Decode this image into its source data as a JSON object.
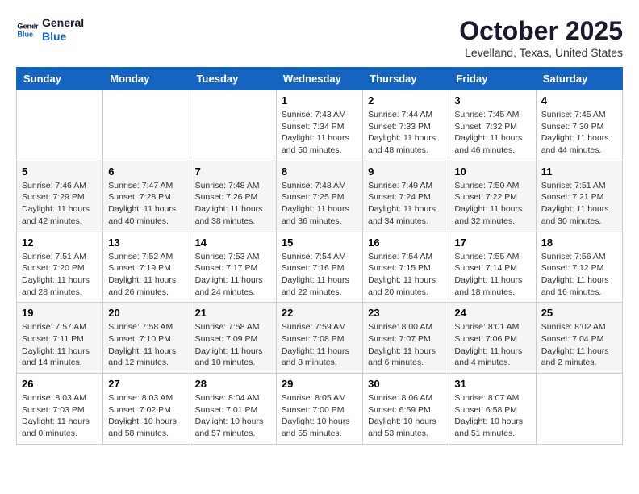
{
  "header": {
    "logo_line1": "General",
    "logo_line2": "Blue",
    "month": "October 2025",
    "location": "Levelland, Texas, United States"
  },
  "weekdays": [
    "Sunday",
    "Monday",
    "Tuesday",
    "Wednesday",
    "Thursday",
    "Friday",
    "Saturday"
  ],
  "weeks": [
    [
      {
        "day": "",
        "content": ""
      },
      {
        "day": "",
        "content": ""
      },
      {
        "day": "",
        "content": ""
      },
      {
        "day": "1",
        "content": "Sunrise: 7:43 AM\nSunset: 7:34 PM\nDaylight: 11 hours\nand 50 minutes."
      },
      {
        "day": "2",
        "content": "Sunrise: 7:44 AM\nSunset: 7:33 PM\nDaylight: 11 hours\nand 48 minutes."
      },
      {
        "day": "3",
        "content": "Sunrise: 7:45 AM\nSunset: 7:32 PM\nDaylight: 11 hours\nand 46 minutes."
      },
      {
        "day": "4",
        "content": "Sunrise: 7:45 AM\nSunset: 7:30 PM\nDaylight: 11 hours\nand 44 minutes."
      }
    ],
    [
      {
        "day": "5",
        "content": "Sunrise: 7:46 AM\nSunset: 7:29 PM\nDaylight: 11 hours\nand 42 minutes."
      },
      {
        "day": "6",
        "content": "Sunrise: 7:47 AM\nSunset: 7:28 PM\nDaylight: 11 hours\nand 40 minutes."
      },
      {
        "day": "7",
        "content": "Sunrise: 7:48 AM\nSunset: 7:26 PM\nDaylight: 11 hours\nand 38 minutes."
      },
      {
        "day": "8",
        "content": "Sunrise: 7:48 AM\nSunset: 7:25 PM\nDaylight: 11 hours\nand 36 minutes."
      },
      {
        "day": "9",
        "content": "Sunrise: 7:49 AM\nSunset: 7:24 PM\nDaylight: 11 hours\nand 34 minutes."
      },
      {
        "day": "10",
        "content": "Sunrise: 7:50 AM\nSunset: 7:22 PM\nDaylight: 11 hours\nand 32 minutes."
      },
      {
        "day": "11",
        "content": "Sunrise: 7:51 AM\nSunset: 7:21 PM\nDaylight: 11 hours\nand 30 minutes."
      }
    ],
    [
      {
        "day": "12",
        "content": "Sunrise: 7:51 AM\nSunset: 7:20 PM\nDaylight: 11 hours\nand 28 minutes."
      },
      {
        "day": "13",
        "content": "Sunrise: 7:52 AM\nSunset: 7:19 PM\nDaylight: 11 hours\nand 26 minutes."
      },
      {
        "day": "14",
        "content": "Sunrise: 7:53 AM\nSunset: 7:17 PM\nDaylight: 11 hours\nand 24 minutes."
      },
      {
        "day": "15",
        "content": "Sunrise: 7:54 AM\nSunset: 7:16 PM\nDaylight: 11 hours\nand 22 minutes."
      },
      {
        "day": "16",
        "content": "Sunrise: 7:54 AM\nSunset: 7:15 PM\nDaylight: 11 hours\nand 20 minutes."
      },
      {
        "day": "17",
        "content": "Sunrise: 7:55 AM\nSunset: 7:14 PM\nDaylight: 11 hours\nand 18 minutes."
      },
      {
        "day": "18",
        "content": "Sunrise: 7:56 AM\nSunset: 7:12 PM\nDaylight: 11 hours\nand 16 minutes."
      }
    ],
    [
      {
        "day": "19",
        "content": "Sunrise: 7:57 AM\nSunset: 7:11 PM\nDaylight: 11 hours\nand 14 minutes."
      },
      {
        "day": "20",
        "content": "Sunrise: 7:58 AM\nSunset: 7:10 PM\nDaylight: 11 hours\nand 12 minutes."
      },
      {
        "day": "21",
        "content": "Sunrise: 7:58 AM\nSunset: 7:09 PM\nDaylight: 11 hours\nand 10 minutes."
      },
      {
        "day": "22",
        "content": "Sunrise: 7:59 AM\nSunset: 7:08 PM\nDaylight: 11 hours\nand 8 minutes."
      },
      {
        "day": "23",
        "content": "Sunrise: 8:00 AM\nSunset: 7:07 PM\nDaylight: 11 hours\nand 6 minutes."
      },
      {
        "day": "24",
        "content": "Sunrise: 8:01 AM\nSunset: 7:06 PM\nDaylight: 11 hours\nand 4 minutes."
      },
      {
        "day": "25",
        "content": "Sunrise: 8:02 AM\nSunset: 7:04 PM\nDaylight: 11 hours\nand 2 minutes."
      }
    ],
    [
      {
        "day": "26",
        "content": "Sunrise: 8:03 AM\nSunset: 7:03 PM\nDaylight: 11 hours\nand 0 minutes."
      },
      {
        "day": "27",
        "content": "Sunrise: 8:03 AM\nSunset: 7:02 PM\nDaylight: 10 hours\nand 58 minutes."
      },
      {
        "day": "28",
        "content": "Sunrise: 8:04 AM\nSunset: 7:01 PM\nDaylight: 10 hours\nand 57 minutes."
      },
      {
        "day": "29",
        "content": "Sunrise: 8:05 AM\nSunset: 7:00 PM\nDaylight: 10 hours\nand 55 minutes."
      },
      {
        "day": "30",
        "content": "Sunrise: 8:06 AM\nSunset: 6:59 PM\nDaylight: 10 hours\nand 53 minutes."
      },
      {
        "day": "31",
        "content": "Sunrise: 8:07 AM\nSunset: 6:58 PM\nDaylight: 10 hours\nand 51 minutes."
      },
      {
        "day": "",
        "content": ""
      }
    ]
  ]
}
